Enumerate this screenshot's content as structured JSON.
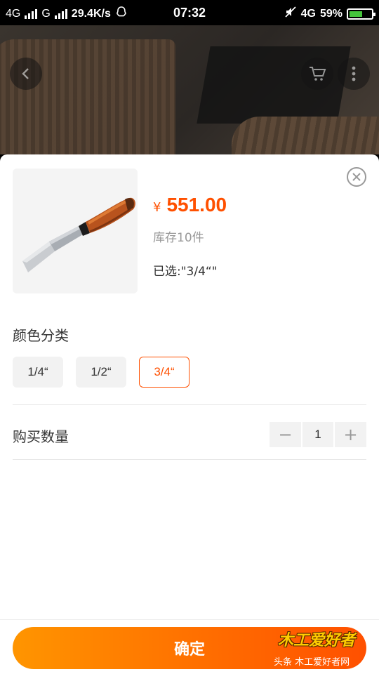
{
  "status_bar": {
    "network_1": "4G",
    "network_2": "G",
    "speed": "29.4K/s",
    "time": "07:32",
    "network_3": "4G",
    "battery": "59%",
    "battery_level": 0.59
  },
  "product": {
    "currency": "¥",
    "price": "551.00",
    "stock": "库存10件",
    "selected": "已选:\"3/4“\""
  },
  "color_section": {
    "title": "颜色分类",
    "options": [
      "1/4“",
      "1/2“",
      "3/4“"
    ],
    "active_index": 2
  },
  "quantity_section": {
    "title": "购买数量",
    "minus": "−",
    "value": "1",
    "plus": "+"
  },
  "confirm_label": "确定",
  "watermark": {
    "logo": "木工爱好者",
    "sub": "头条  木工爱好者网"
  },
  "colors": {
    "accent": "#ff5000",
    "button_start": "#ff9500",
    "button_end": "#ff5000"
  }
}
